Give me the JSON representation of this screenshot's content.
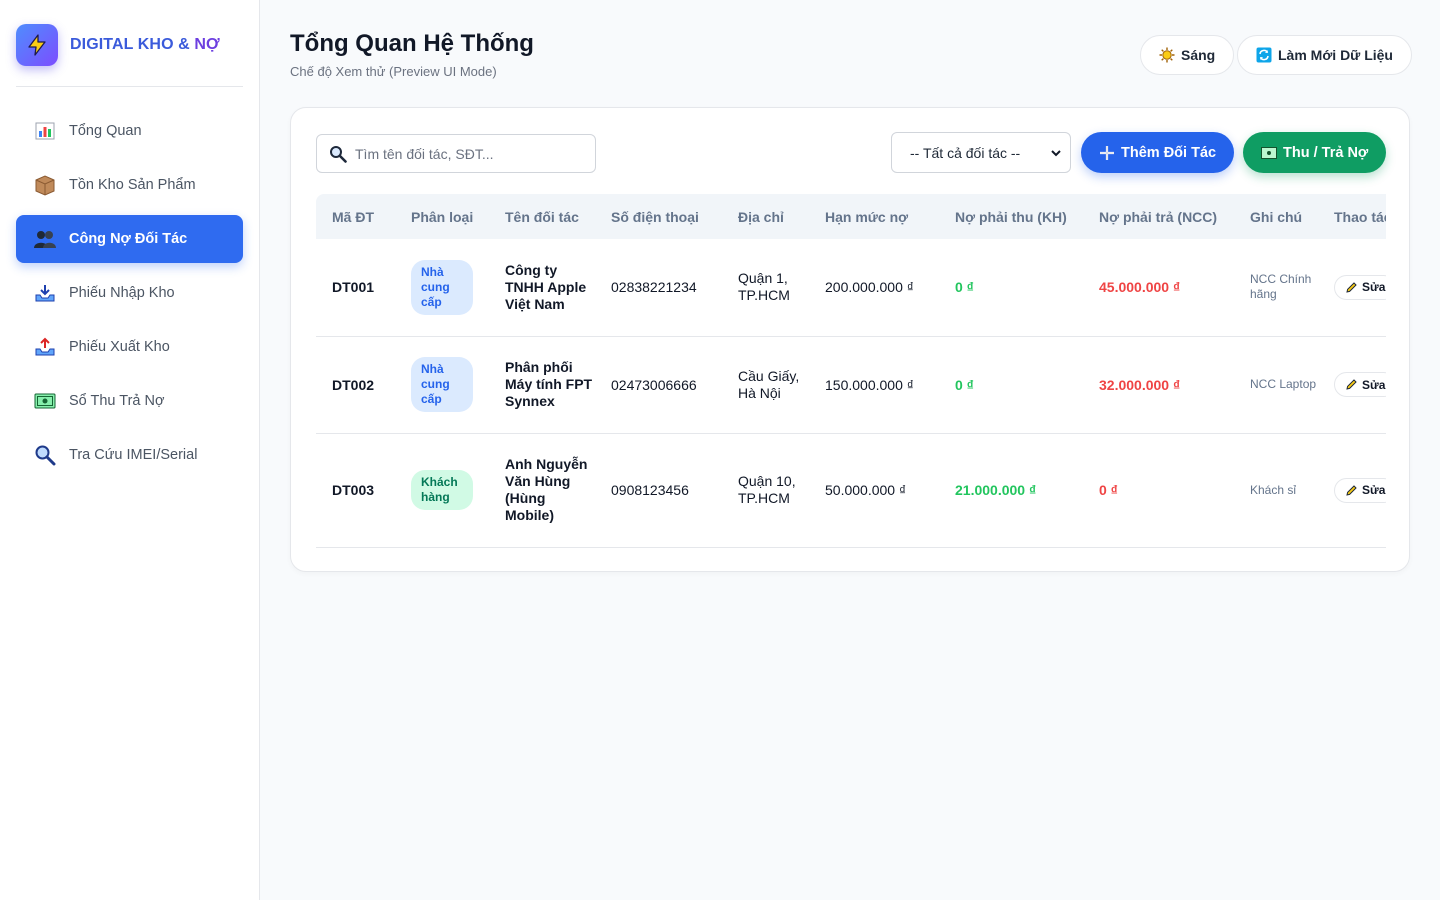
{
  "brand": {
    "name_part1": "DIGITAL KHO & ",
    "name_part2": "NỢ"
  },
  "nav": [
    {
      "label": "Tổng Quan",
      "icon": "bar-chart-icon"
    },
    {
      "label": "Tồn Kho Sản Phẩm",
      "icon": "box-icon"
    },
    {
      "label": "Công Nợ Đối Tác",
      "icon": "users-icon",
      "active": true
    },
    {
      "label": "Phiếu Nhập Kho",
      "icon": "inbox-tray-icon"
    },
    {
      "label": "Phiếu Xuất Kho",
      "icon": "outbox-tray-icon"
    },
    {
      "label": "Sổ Thu Trả Nợ",
      "icon": "cash-icon"
    },
    {
      "label": "Tra Cứu IMEI/Serial",
      "icon": "search-icon"
    }
  ],
  "header": {
    "title": "Tổng Quan Hệ Thống",
    "subtitle": "Chế độ Xem thử (Preview UI Mode)",
    "theme_label": "Sáng",
    "refresh_label": "Làm Mới Dữ Liệu"
  },
  "toolbar": {
    "search_placeholder": "Tìm tên đối tác, SĐT...",
    "filter_selected": "-- Tất cả đối tác --",
    "add_label": "Thêm Đối Tác",
    "pay_label": "Thu / Trả Nợ"
  },
  "table": {
    "headers": [
      "Mã ĐT",
      "Phân loại",
      "Tên đối tác",
      "Số điện thoại",
      "Địa chỉ",
      "Hạn mức nợ",
      "Nợ phải thu (KH)",
      "Nợ phải trả (NCC)",
      "Ghi chú",
      "Thao tác"
    ],
    "edit_label": "Sửa",
    "rows": [
      {
        "code": "DT001",
        "type": "Nhà cung cấp",
        "type_kind": "ncc",
        "name": "Công ty TNHH Apple Việt Nam",
        "phone": "02838221234",
        "address": "Quận 1, TP.HCM",
        "limit": "200.000.000 ₫",
        "receivable": "0 ₫",
        "payable": "45.000.000 ₫",
        "note": "NCC Chính hãng"
      },
      {
        "code": "DT002",
        "type": "Nhà cung cấp",
        "type_kind": "ncc",
        "name": "Phân phối Máy tính FPT Synnex",
        "phone": "02473006666",
        "address": "Cầu Giấy, Hà Nội",
        "limit": "150.000.000 ₫",
        "receivable": "0 ₫",
        "payable": "32.000.000 ₫",
        "note": "NCC Laptop"
      },
      {
        "code": "DT003",
        "type": "Khách hàng",
        "type_kind": "kh",
        "name": "Anh Nguyễn Văn Hùng (Hùng Mobile)",
        "phone": "0908123456",
        "address": "Quận 10, TP.HCM",
        "limit": "50.000.000 ₫",
        "receivable": "21.000.000 ₫",
        "payable": "0 ₫",
        "note": "Khách sỉ"
      }
    ]
  },
  "colors": {
    "primary": "#2563eb",
    "success": "#0f9d63",
    "debt_red": "#ef4444",
    "credit_green": "#22c55e"
  }
}
